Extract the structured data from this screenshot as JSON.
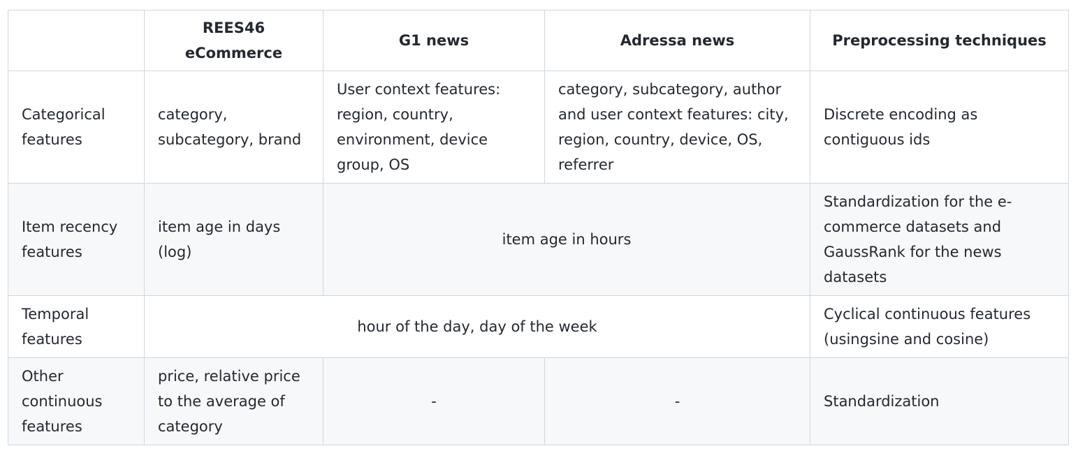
{
  "headers": [
    "",
    "REES46 eCommerce",
    "G1 news",
    "Adressa news",
    "Preprocessing techniques"
  ],
  "rows": [
    {
      "label": "Categorical features",
      "rees46": "category, subcategory, brand",
      "g1": "User context features: region, country, environment, device group, OS",
      "adressa": "category, subcategory, author and user context features: city, region, country, device, OS, referrer",
      "technique": "Discrete encoding as contiguous ids"
    },
    {
      "label": "Item recency features",
      "rees46": "item age in days (log)",
      "news_merged": "item age in hours",
      "technique": "Standardization for the e-commerce datasets and GaussRank for the news datasets"
    },
    {
      "label": "Temporal features",
      "all_merged": "hour of the day, day of the week",
      "technique": "Cyclical continuous features (usingsine and cosine)"
    },
    {
      "label": "Other continuous features",
      "rees46": "price, relative price to the average of category",
      "g1": "-",
      "adressa": "-",
      "technique": "Standardization"
    }
  ]
}
